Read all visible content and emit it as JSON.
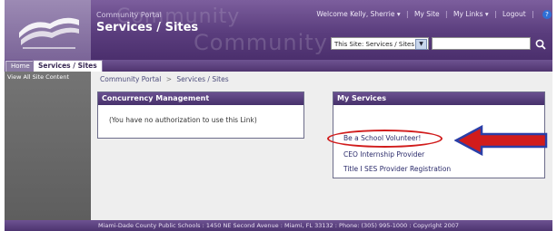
{
  "header": {
    "portal_small": "Community Portal",
    "title": "Services / Sites",
    "watermark_top": "Community",
    "watermark_bottom": "Community",
    "welcome": "Welcome Kelly, Sherrie",
    "my_site": "My Site",
    "my_links": "My Links",
    "logout": "Logout",
    "help_icon": "?",
    "search_scope": "This Site: Services / Sites",
    "search_value": ""
  },
  "tabs": {
    "home": "Home",
    "services": "Services / Sites"
  },
  "leftnav": {
    "item": "View All Site Content"
  },
  "breadcrumb": {
    "root": "Community Portal",
    "separator": ">",
    "current": "Services / Sites"
  },
  "webparts": {
    "concurrency": {
      "title": "Concurrency Management",
      "message": "(You have no authorization to use this Link)"
    },
    "services": {
      "title": "My Services",
      "links": [
        "Be a School Volunteer!",
        "CEO Internship Provider",
        "Title I SES Provider Registration"
      ]
    }
  },
  "footer": {
    "text": "Miami-Dade County Public Schools : 1450 NE Second Avenue : Miami, FL 33132 : Phone: (305) 995-1000 : Copyright 2007"
  },
  "icons": {
    "logo": "book-logo-icon",
    "dropdown": "chevron-down-icon",
    "search": "search-icon",
    "annotation_arrow": "red-arrow-icon"
  },
  "colors": {
    "header_purple": "#5a3d7d",
    "annotation_red": "#d11c1c",
    "annotation_blue": "#2a3fa8"
  }
}
